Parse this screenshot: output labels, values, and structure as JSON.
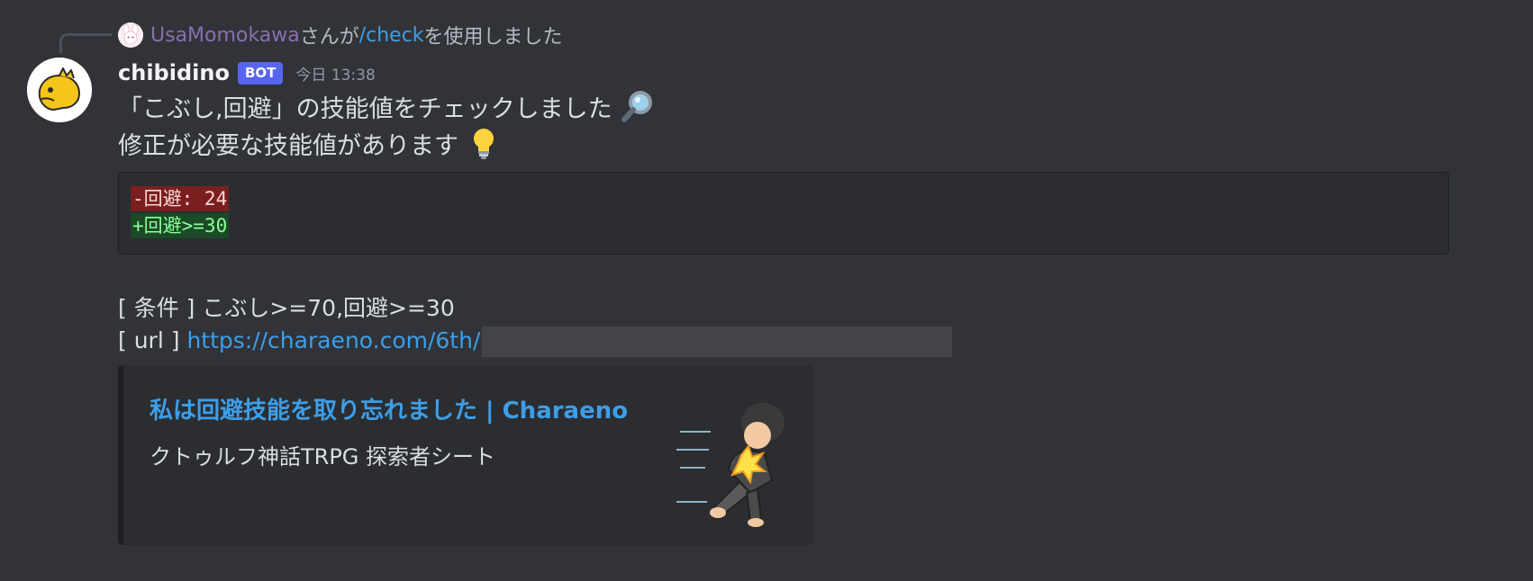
{
  "command_context": {
    "user": "UsaMomokawa",
    "text_middle": "さんが",
    "command": "/check",
    "text_end": "を使用しました"
  },
  "message": {
    "username": "chibidino",
    "bot_tag": "BOT",
    "timestamp": "今日 13:38",
    "line1": "「こぶし,回避」の技能値をチェックしました",
    "line1_emoji": "magnifying-glass-icon",
    "line2": "修正が必要な技能値があります",
    "line2_emoji": "light-bulb-icon"
  },
  "diff": {
    "removed": "-回避: 24",
    "added": "+回避>=30"
  },
  "conditions": {
    "label": "[ 条件 ]",
    "value": "こぶし>=70,回避>=30"
  },
  "url": {
    "label": "[ url ]",
    "link": "https://charaeno.com/6th/"
  },
  "embed": {
    "title": "私は回避技能を取り忘れました | Charaeno",
    "description": "クトゥルフ神話TRPG 探索者シート"
  },
  "colors": {
    "background": "#313338",
    "bot_tag": "#5865f2",
    "link": "#3d9ee8",
    "command_user": "#8a6fb0",
    "diff_removed_bg": "#7a1f1f",
    "diff_added_bg": "#1a4a26"
  }
}
